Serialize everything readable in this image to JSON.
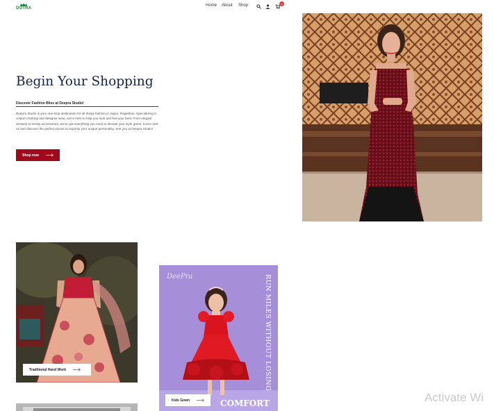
{
  "header": {
    "logo_text": "DOTRA",
    "nav": [
      "Home",
      "About",
      "Shop"
    ],
    "icons": [
      "search-icon",
      "user-icon",
      "cart-icon"
    ],
    "cart_count": "0"
  },
  "hero": {
    "title": "Begin Your Shopping",
    "subtitle": "Discover Fashion Bliss at Deepra Studio!",
    "body": "Deepra Studio is your one-stop destination for all things fashion in Jaipur, Rajasthan. Specializing in custom clothing and designer wear, we're here to help you look and feel your best. From elegant dresses to trendy accessories, we've got everything you need to elevate your style game. Come visit us and discover the perfect pieces to express your unique personality. See you at Deepra Studio!",
    "button_label": "Shop now"
  },
  "cards": [
    {
      "label": "Traditional Hand Work"
    },
    {
      "label": "Kids Gown",
      "poster_text": "RUN MILES WITHOUT LOSING",
      "poster_bottom": "COMFORT",
      "poster_logo": "DeePra"
    }
  ],
  "overlay": {
    "watermark": "Activate Wi"
  },
  "colors": {
    "accent": "#a0081b",
    "title": "#14224a",
    "logo": "#1f8a3a"
  }
}
